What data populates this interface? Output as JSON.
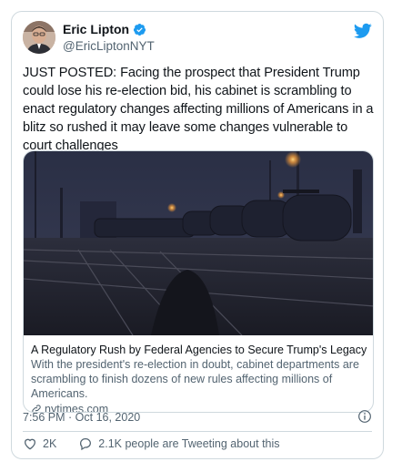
{
  "author": {
    "name": "Eric Lipton",
    "handle": "@EricLiptonNYT"
  },
  "tweet": {
    "text": "JUST POSTED: Facing the prospect that President Trump could lose his re-election bid, his cabinet is scrambling to enact regulatory changes affecting millions of Americans in a blitz so rushed it may leave some changes vulnerable to court challenges"
  },
  "link_card": {
    "title": "A Regulatory Rush by Federal Agencies to Secure Trump's Legacy",
    "description": "With the president's re-election in doubt, cabinet departments are scrambling to finish dozens of new rules affecting millions of Americans.",
    "domain": "nytimes.com"
  },
  "meta": {
    "timestamp": "7:56 PM · Oct 16, 2020"
  },
  "actions": {
    "likes": "2K",
    "replies_text": "2.1K people are Tweeting about this"
  },
  "colors": {
    "brand_blue": "#1d9bf0",
    "text": "#0f1419",
    "secondary": "#536471",
    "border": "#cfd9de"
  },
  "icons": [
    "verified-badge-icon",
    "twitter-bird-icon",
    "link-icon",
    "info-icon",
    "heart-icon",
    "reply-bubble-icon"
  ]
}
